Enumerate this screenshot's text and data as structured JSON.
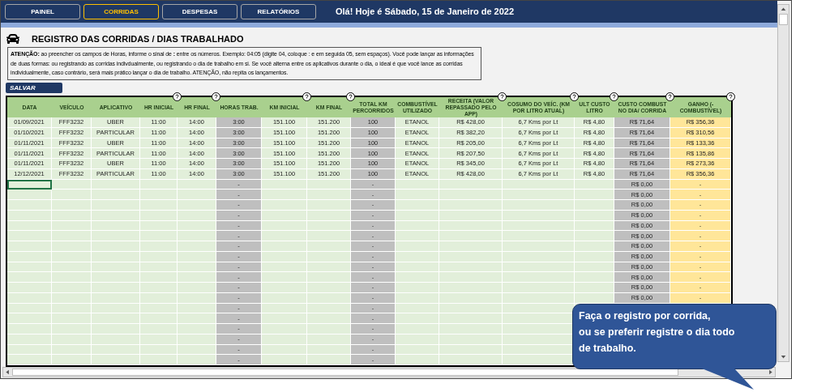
{
  "nav": {
    "tabs": [
      {
        "label": "PAINEL",
        "selected": false
      },
      {
        "label": "CORRIDAS",
        "selected": true
      },
      {
        "label": "DESPESAS",
        "selected": false
      },
      {
        "label": "RELATÓRIOS",
        "selected": false
      }
    ],
    "greeting": "Olá! Hoje é Sábado, 15 de Janeiro de 2022"
  },
  "title": "REGISTRO DAS CORRIDAS / DIAS TRABALHADO",
  "notice": "**ATENÇÃO:** ao preencher os campos de Horas, informe o sinal de **:** entre os números. Exemplo: 04:05 (digite 04, coloque : e em seguida 05, sem espaços). Você pode lançar as informações de duas formas: ou registrando as corridas indivdualmente, ou registrando o dia de trabalho em si. Se você alterna entre os aplicativos durante o dia, o ideal é que você lance as corridas individualmente, caso contrário, será mais prático lançar o dia de trabalho. ATENÇÃO, não repita os lançamentos.",
  "save_button": "SALVAR",
  "table": {
    "columns": [
      {
        "label": "DATA",
        "kind": "input",
        "help": false
      },
      {
        "label": "VEÍCULO",
        "kind": "input",
        "help": false
      },
      {
        "label": "APLICATIVO",
        "kind": "input",
        "help": false
      },
      {
        "label": "HR INICIAL",
        "kind": "input",
        "help": true
      },
      {
        "label": "HR FINAL",
        "kind": "input",
        "help": true
      },
      {
        "label": "HORAS TRAB.",
        "kind": "calc",
        "help": false
      },
      {
        "label": "KM INICIAL",
        "kind": "input",
        "help": true
      },
      {
        "label": "KM FINAL",
        "kind": "input",
        "help": true
      },
      {
        "label": "TOTAL KM PERCORRIDOS",
        "kind": "calc",
        "help": false
      },
      {
        "label": "COMBUSTÍVEL UTILIZADO",
        "kind": "input",
        "help": false
      },
      {
        "label": "RECEITA (VALOR REPASSADO PELO APP)",
        "kind": "input",
        "help": true
      },
      {
        "label": "COSUMO DO VEÍC. (KM POR LITRO ATUAL)",
        "kind": "input",
        "help": true
      },
      {
        "label": "ULT CUSTO LITRO",
        "kind": "input",
        "help": true
      },
      {
        "label": "CUSTO COMBUST NO DIA/ CORRIDA",
        "kind": "calc",
        "help": true
      },
      {
        "label": "GANHO (- COMBUSTÍVEL)",
        "kind": "result",
        "help": true
      }
    ],
    "rows": [
      {
        "selected": false,
        "cells": [
          "01/09/2021",
          "FFF3232",
          "UBER",
          "11:00",
          "14:00",
          "3:00",
          "151.100",
          "151.200",
          "100",
          "ETANOL",
          "R$ 428,00",
          "6,7 Kms por Lt",
          "R$ 4,80",
          "R$ 71,64",
          "R$ 356,36"
        ]
      },
      {
        "selected": false,
        "cells": [
          "01/10/2021",
          "FFF3232",
          "PARTICULAR",
          "11:00",
          "14:00",
          "3:00",
          "151.100",
          "151.200",
          "100",
          "ETANOL",
          "R$ 382,20",
          "6,7 Kms por Lt",
          "R$ 4,80",
          "R$ 71,64",
          "R$ 310,56"
        ]
      },
      {
        "selected": false,
        "cells": [
          "01/11/2021",
          "FFF3232",
          "UBER",
          "11:00",
          "14:00",
          "3:00",
          "151.100",
          "151.200",
          "100",
          "ETANOL",
          "R$ 205,00",
          "6,7 Kms por Lt",
          "R$ 4,80",
          "R$ 71,64",
          "R$ 133,36"
        ]
      },
      {
        "selected": false,
        "cells": [
          "01/11/2021",
          "FFF3232",
          "PARTICULAR",
          "11:00",
          "14:00",
          "3:00",
          "151.100",
          "151.200",
          "100",
          "ETANOL",
          "R$ 207,50",
          "6,7 Kms por Lt",
          "R$ 4,80",
          "R$ 71,64",
          "R$ 135,86"
        ]
      },
      {
        "selected": false,
        "cells": [
          "01/11/2021",
          "FFF3232",
          "UBER",
          "11:00",
          "14:00",
          "3:00",
          "151.100",
          "151.200",
          "100",
          "ETANOL",
          "R$ 345,00",
          "6,7 Kms por Lt",
          "R$ 4,80",
          "R$ 71,64",
          "R$ 273,36"
        ]
      },
      {
        "selected": false,
        "cells": [
          "12/12/2021",
          "FFF3232",
          "PARTICULAR",
          "11:00",
          "14:00",
          "3:00",
          "151.100",
          "151.200",
          "100",
          "ETANOL",
          "R$ 428,00",
          "6,7 Kms por Lt",
          "R$ 4,80",
          "R$ 71,64",
          "R$ 356,36"
        ]
      },
      {
        "selected": true,
        "cells": [
          null,
          null,
          null,
          null,
          null,
          "-",
          null,
          null,
          "-",
          null,
          null,
          null,
          null,
          "R$ 0,00",
          "-"
        ]
      },
      {
        "selected": false,
        "cells": [
          null,
          null,
          null,
          null,
          null,
          "-",
          null,
          null,
          "-",
          null,
          null,
          null,
          null,
          "R$ 0,00",
          "-"
        ]
      },
      {
        "selected": false,
        "cells": [
          null,
          null,
          null,
          null,
          null,
          "-",
          null,
          null,
          "-",
          null,
          null,
          null,
          null,
          "R$ 0,00",
          "-"
        ]
      },
      {
        "selected": false,
        "cells": [
          null,
          null,
          null,
          null,
          null,
          "-",
          null,
          null,
          "-",
          null,
          null,
          null,
          null,
          "R$ 0,00",
          "-"
        ]
      },
      {
        "selected": false,
        "cells": [
          null,
          null,
          null,
          null,
          null,
          "-",
          null,
          null,
          "-",
          null,
          null,
          null,
          null,
          "R$ 0,00",
          "-"
        ]
      },
      {
        "selected": false,
        "cells": [
          null,
          null,
          null,
          null,
          null,
          "-",
          null,
          null,
          "-",
          null,
          null,
          null,
          null,
          "R$ 0,00",
          "-"
        ]
      },
      {
        "selected": false,
        "cells": [
          null,
          null,
          null,
          null,
          null,
          "-",
          null,
          null,
          "-",
          null,
          null,
          null,
          null,
          "R$ 0,00",
          "-"
        ]
      },
      {
        "selected": false,
        "cells": [
          null,
          null,
          null,
          null,
          null,
          "-",
          null,
          null,
          "-",
          null,
          null,
          null,
          null,
          "R$ 0,00",
          "-"
        ]
      },
      {
        "selected": false,
        "cells": [
          null,
          null,
          null,
          null,
          null,
          "-",
          null,
          null,
          "-",
          null,
          null,
          null,
          null,
          "R$ 0,00",
          "-"
        ]
      },
      {
        "selected": false,
        "cells": [
          null,
          null,
          null,
          null,
          null,
          "-",
          null,
          null,
          "-",
          null,
          null,
          null,
          null,
          "R$ 0,00",
          "-"
        ]
      },
      {
        "selected": false,
        "cells": [
          null,
          null,
          null,
          null,
          null,
          "-",
          null,
          null,
          "-",
          null,
          null,
          null,
          null,
          "R$ 0,00",
          "-"
        ]
      },
      {
        "selected": false,
        "cells": [
          null,
          null,
          null,
          null,
          null,
          "-",
          null,
          null,
          "-",
          null,
          null,
          null,
          null,
          "R$ 0,00",
          "-"
        ]
      },
      {
        "selected": false,
        "cells": [
          null,
          null,
          null,
          null,
          null,
          "-",
          null,
          null,
          "-",
          null,
          null,
          null
        ]
      },
      {
        "selected": false,
        "cells": [
          null,
          null,
          null,
          null,
          null,
          "-",
          null,
          null,
          "-",
          null,
          null,
          null
        ]
      },
      {
        "selected": false,
        "cells": [
          null,
          null,
          null,
          null,
          null,
          "-",
          null,
          null,
          "-",
          null,
          null,
          null
        ]
      },
      {
        "selected": false,
        "cells": [
          null,
          null,
          null,
          null,
          null,
          "-",
          null,
          null,
          "-",
          null,
          null,
          null
        ]
      },
      {
        "selected": false,
        "cells": [
          null,
          null,
          null,
          null,
          null,
          "-",
          null,
          null,
          "-",
          null,
          null,
          null
        ]
      },
      {
        "selected": false,
        "cells": [
          null,
          null,
          null,
          null,
          null,
          "-",
          null,
          null,
          "-",
          null,
          null,
          null
        ]
      }
    ]
  },
  "callout": "Faça o registro por corrida,\nou se preferir registre o dia todo\nde trabalho."
}
